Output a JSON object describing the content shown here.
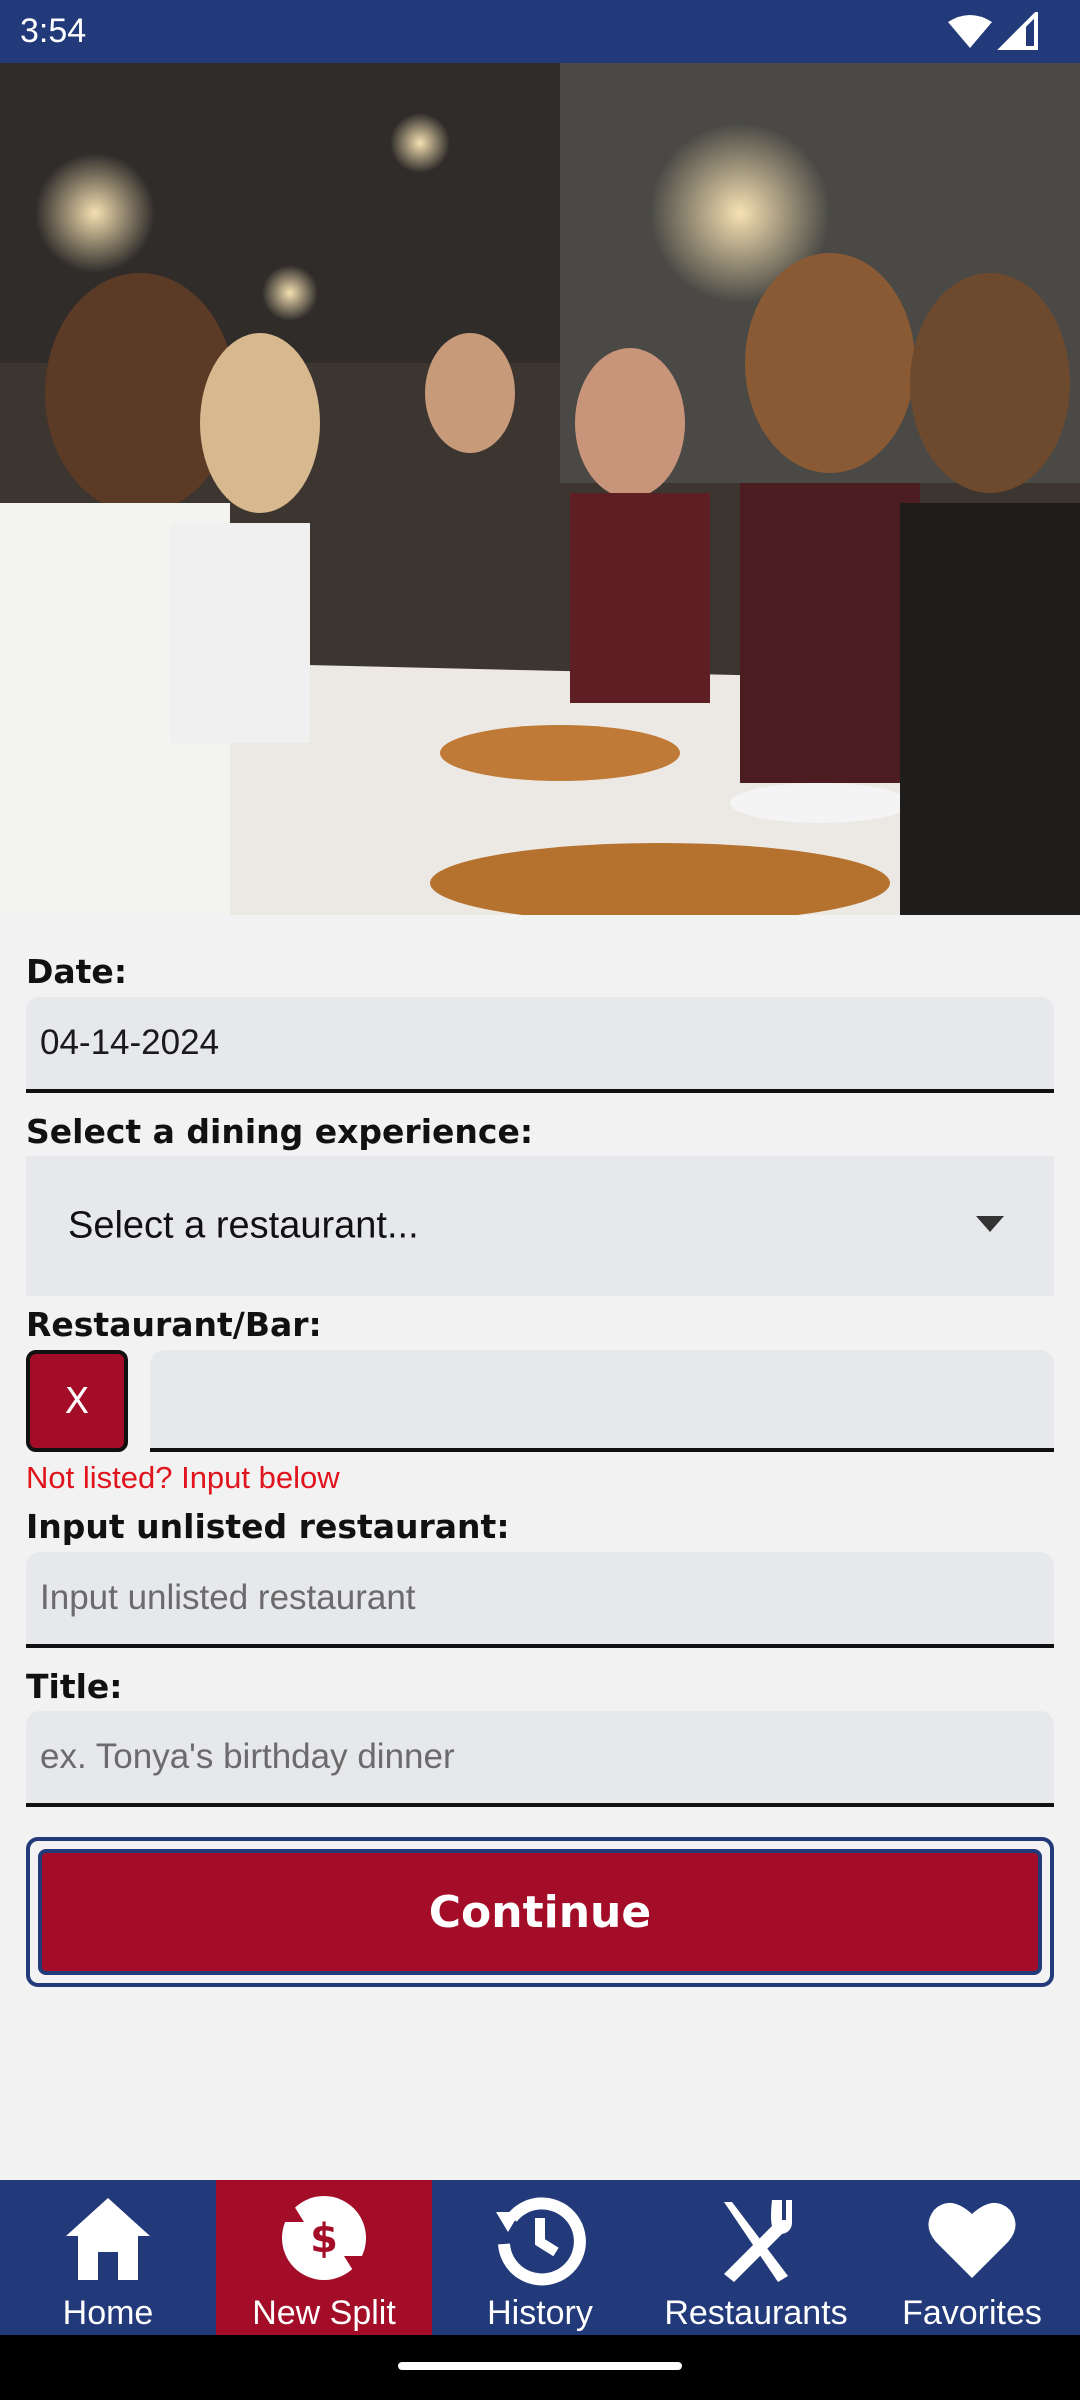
{
  "status_bar": {
    "time": "3:54"
  },
  "form": {
    "date_label": "Date:",
    "date_value": "04-14-2024",
    "dining_label": "Select a dining experience:",
    "dining_select": "Select a restaurant...",
    "restaurant_label": "Restaurant/Bar:",
    "clear_button": "X",
    "restaurant_value": "",
    "not_listed": "Not listed? Input below",
    "unlisted_label": "Input unlisted restaurant:",
    "unlisted_placeholder": "Input unlisted restaurant",
    "title_label": "Title:",
    "title_placeholder": "ex. Tonya's birthday dinner",
    "continue_label": "Continue"
  },
  "nav": {
    "items": [
      {
        "label": "Home",
        "icon": "home-icon"
      },
      {
        "label": "New Split",
        "icon": "split-dollar-icon",
        "active": true
      },
      {
        "label": "History",
        "icon": "history-icon"
      },
      {
        "label": "Restaurants",
        "icon": "fork-knife-icon"
      },
      {
        "label": "Favorites",
        "icon": "heart-icon"
      }
    ]
  },
  "colors": {
    "primary": "#223a7a",
    "accent": "#a30d28",
    "error": "#e0141c"
  }
}
